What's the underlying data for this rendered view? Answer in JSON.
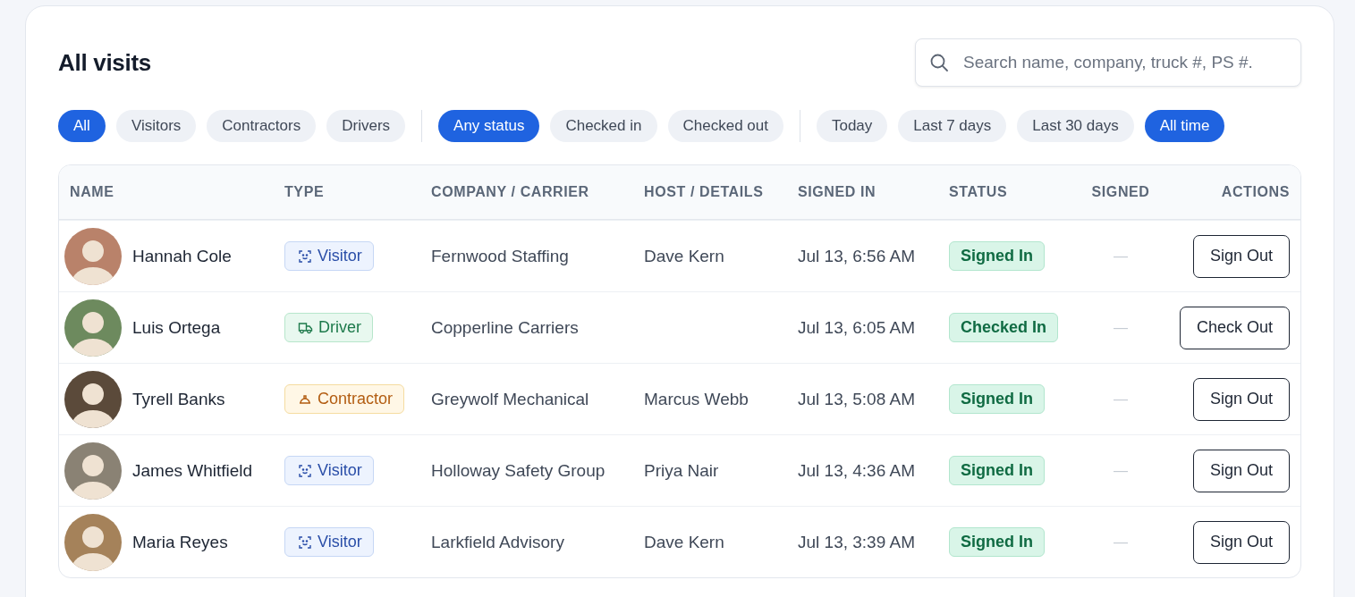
{
  "title": "All visits",
  "search": {
    "placeholder": "Search name, company, truck #, PS #."
  },
  "filter_groups": [
    {
      "chips": [
        {
          "label": "All",
          "selected": true
        },
        {
          "label": "Visitors",
          "selected": false
        },
        {
          "label": "Contractors",
          "selected": false
        },
        {
          "label": "Drivers",
          "selected": false
        }
      ]
    },
    {
      "chips": [
        {
          "label": "Any status",
          "selected": true
        },
        {
          "label": "Checked in",
          "selected": false
        },
        {
          "label": "Checked out",
          "selected": false
        }
      ]
    },
    {
      "chips": [
        {
          "label": "Today",
          "selected": false
        },
        {
          "label": "Last 7 days",
          "selected": false
        },
        {
          "label": "Last 30 days",
          "selected": false
        },
        {
          "label": "All time",
          "selected": true
        }
      ]
    }
  ],
  "table": {
    "columns": [
      "NAME",
      "TYPE",
      "COMPANY / CARRIER",
      "HOST / DETAILS",
      "SIGNED IN",
      "STATUS",
      "SIGNED",
      "ACTIONS"
    ],
    "rows": [
      {
        "name": "Hannah Cole",
        "type": {
          "kind": "visitor",
          "label": "Visitor"
        },
        "company": "Fernwood Staffing",
        "host": "Dave Kern",
        "signed_in": "Jul 13, 6:56 AM",
        "status": "Signed In",
        "signed": "—",
        "action": "Sign Out"
      },
      {
        "name": "Luis Ortega",
        "type": {
          "kind": "driver",
          "label": "Driver"
        },
        "company": "Copperline Carriers",
        "signed_in": "Jul 13, 6:05 AM",
        "status": "Checked In",
        "signed": "—",
        "action": "Check Out"
      },
      {
        "name": "Tyrell Banks",
        "type": {
          "kind": "contractor",
          "label": "Contractor"
        },
        "company": "Greywolf Mechanical",
        "host": "Marcus Webb",
        "signed_in": "Jul 13, 5:08 AM",
        "status": "Signed In",
        "signed": "—",
        "action": "Sign Out"
      },
      {
        "name": "James Whitfield",
        "type": {
          "kind": "visitor",
          "label": "Visitor"
        },
        "company": "Holloway Safety Group",
        "host": "Priya Nair",
        "signed_in": "Jul 13, 4:36 AM",
        "status": "Signed In",
        "signed": "—",
        "action": "Sign Out"
      },
      {
        "name": "Maria Reyes",
        "type": {
          "kind": "visitor",
          "label": "Visitor"
        },
        "company": "Larkfield Advisory",
        "host": "Dave Kern",
        "signed_in": "Jul 13, 3:39 AM",
        "status": "Signed In",
        "signed": "—",
        "action": "Sign Out"
      }
    ]
  }
}
